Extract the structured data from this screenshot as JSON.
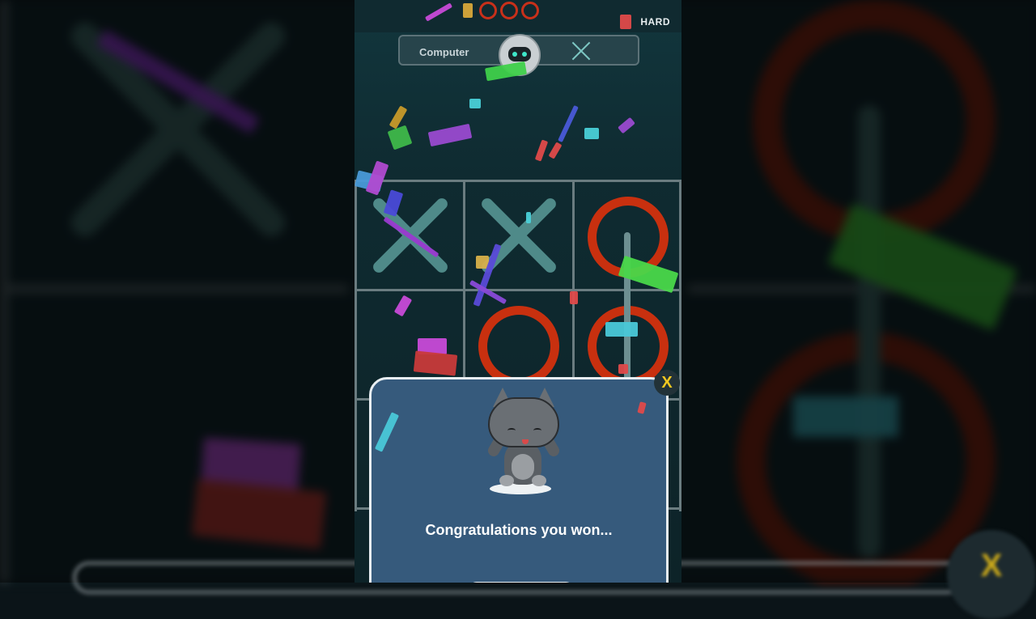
{
  "header": {
    "difficulty": "HARD",
    "rounds": 3
  },
  "opponent": {
    "name": "Computer",
    "avatar": "robot-icon",
    "mark": "X"
  },
  "board": {
    "cells": [
      "X",
      "X",
      "O",
      "",
      "O",
      "O",
      "",
      "",
      ""
    ]
  },
  "result": {
    "message": "Congratulations you won...",
    "close_label": "X",
    "mascot": "happy-cat-icon"
  },
  "colors": {
    "x_mark": "#4f8a89",
    "o_mark": "#c8300f",
    "popup_bg": "#365a7c",
    "close_accent": "#f2c820"
  }
}
